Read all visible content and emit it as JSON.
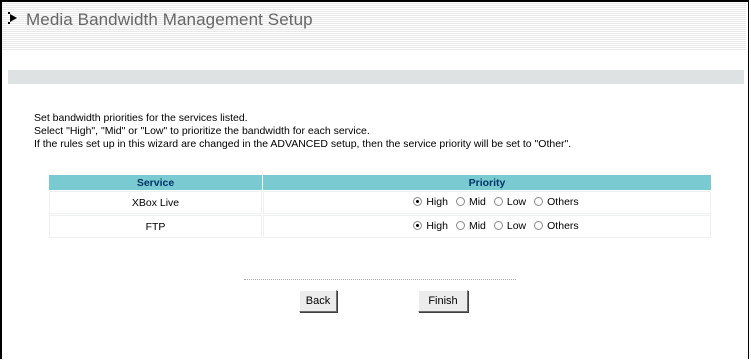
{
  "header": {
    "title": "Media Bandwidth Management Setup",
    "icon": "arrow-right-icon"
  },
  "instructions": {
    "line1": "Set bandwidth priorities for the services listed.",
    "line2": "Select \"High\", \"Mid\" or \"Low\" to prioritize the bandwidth for each service.",
    "line3": "If the rules set up in this wizard are changed in the ADVANCED setup, then the service priority will be set to \"Other\"."
  },
  "table": {
    "headers": {
      "service": "Service",
      "priority": "Priority"
    },
    "rows": [
      {
        "service": "XBox Live",
        "options": [
          "High",
          "Mid",
          "Low",
          "Others"
        ],
        "selected": "High"
      },
      {
        "service": "FTP",
        "options": [
          "High",
          "Mid",
          "Low",
          "Others"
        ],
        "selected": "High"
      }
    ]
  },
  "buttons": {
    "back": "Back",
    "finish": "Finish"
  },
  "colors": {
    "table_header_bg": "#79cbd1",
    "table_header_text": "#003366",
    "title_text": "#666666",
    "stripe": "#dfe2e2"
  }
}
